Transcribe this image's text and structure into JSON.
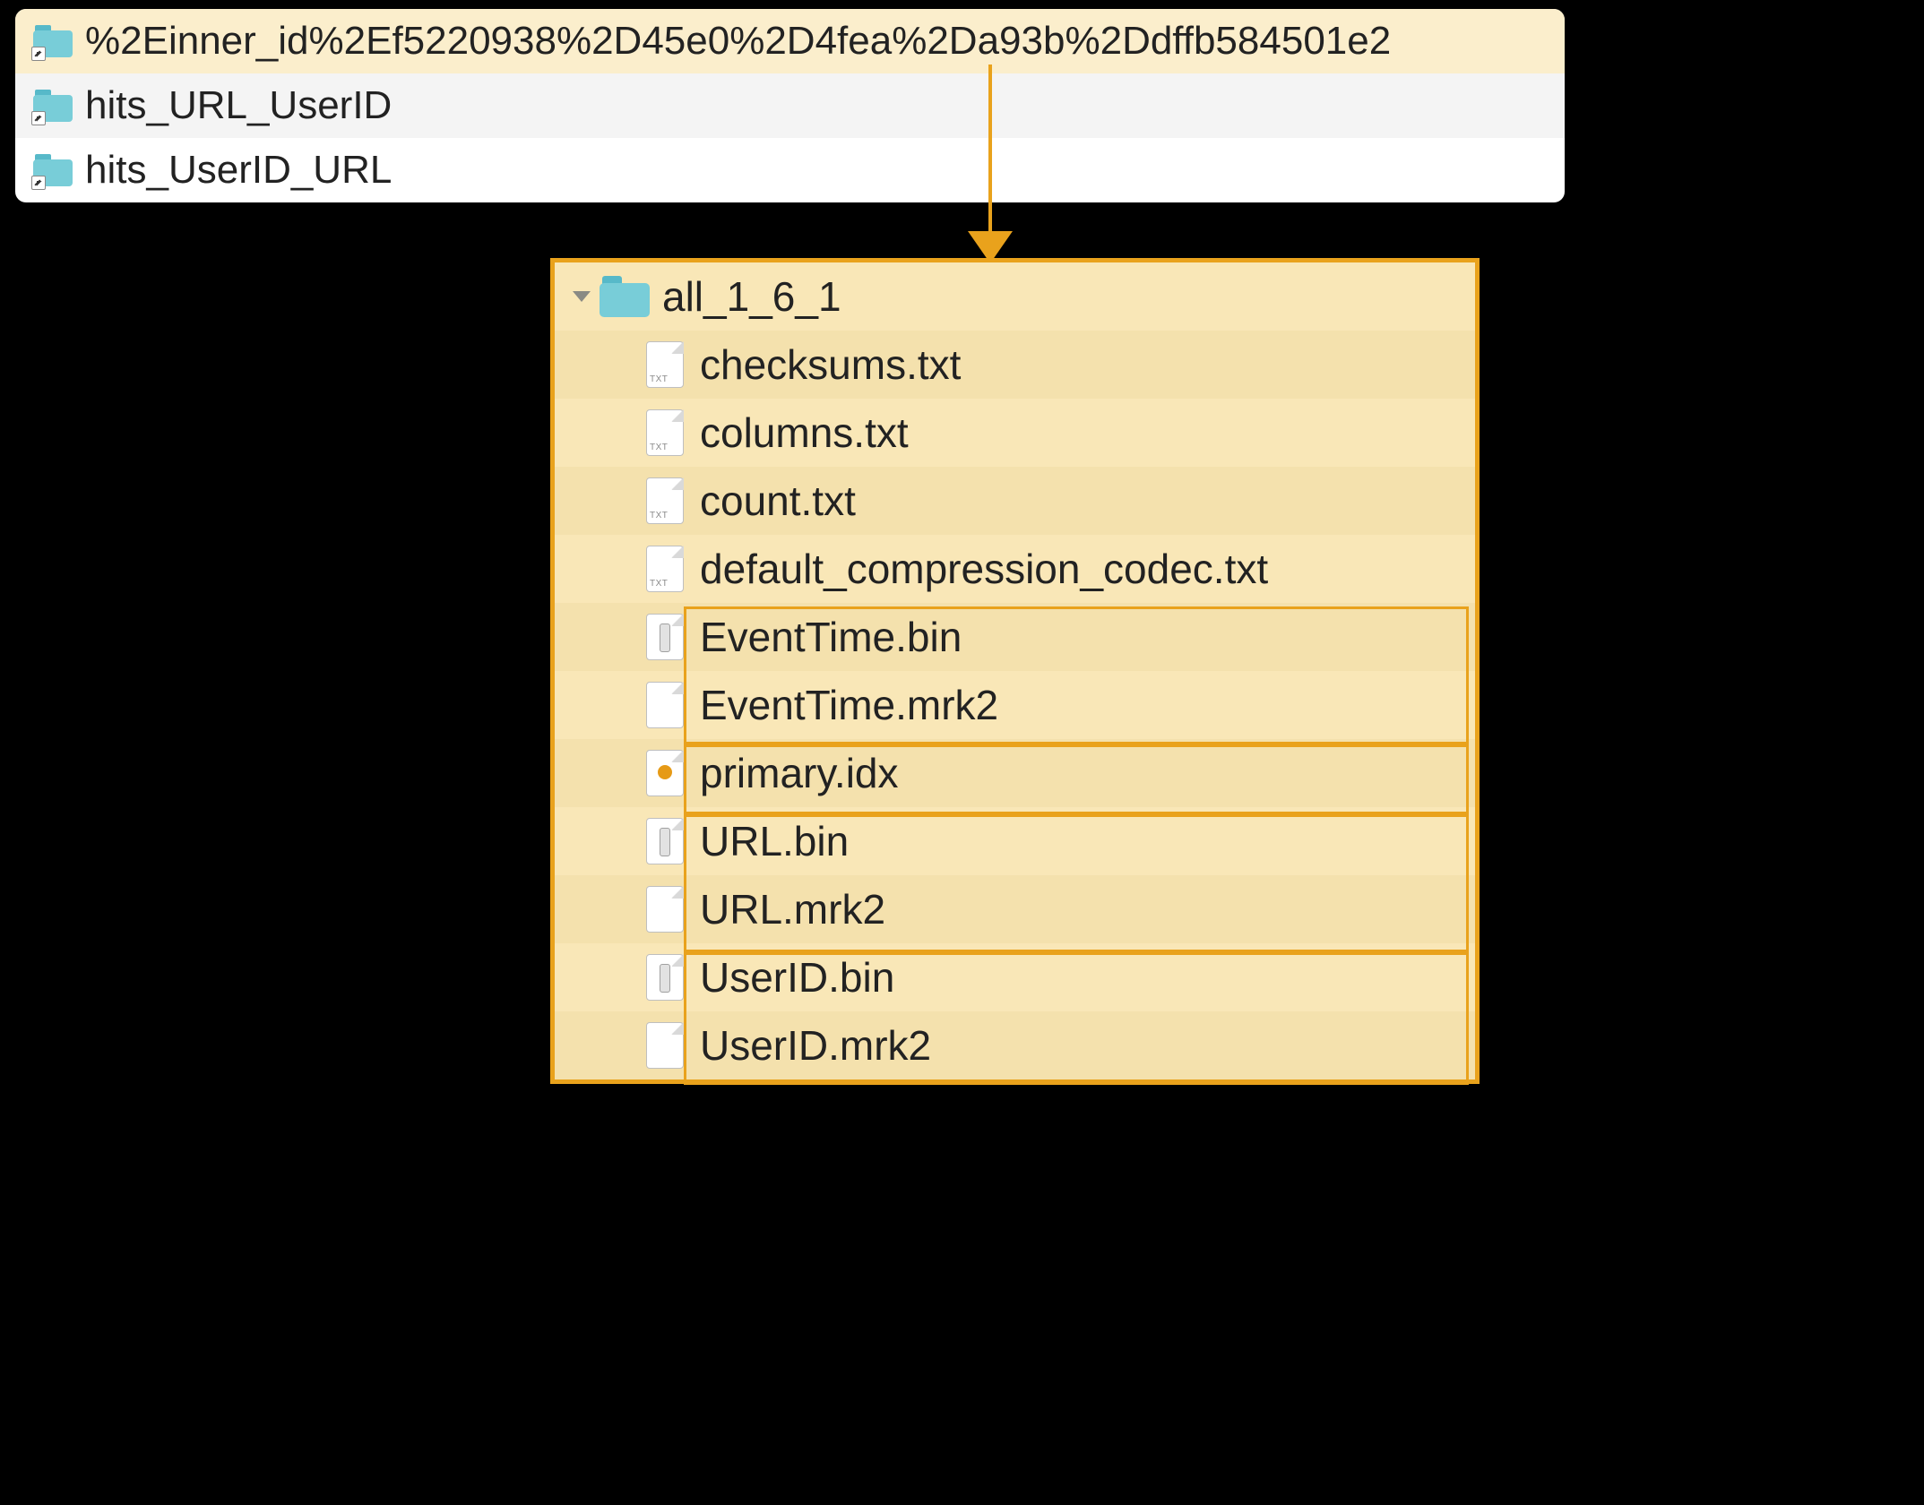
{
  "top_folders": {
    "items": [
      {
        "label": "%2Einner_id%2Ef5220938%2D45e0%2D4fea%2Da93b%2Ddffb584501e2"
      },
      {
        "label": "hits_URL_UserID"
      },
      {
        "label": "hits_UserID_URL"
      }
    ]
  },
  "detail": {
    "parent": "all_1_6_1",
    "files": [
      {
        "label": "checksums.txt"
      },
      {
        "label": "columns.txt"
      },
      {
        "label": "count.txt"
      },
      {
        "label": "default_compression_codec.txt"
      },
      {
        "label": "EventTime.bin"
      },
      {
        "label": "EventTime.mrk2"
      },
      {
        "label": "primary.idx"
      },
      {
        "label": "URL.bin"
      },
      {
        "label": "URL.mrk2"
      },
      {
        "label": "UserID.bin"
      },
      {
        "label": "UserID.mrk2"
      }
    ]
  }
}
